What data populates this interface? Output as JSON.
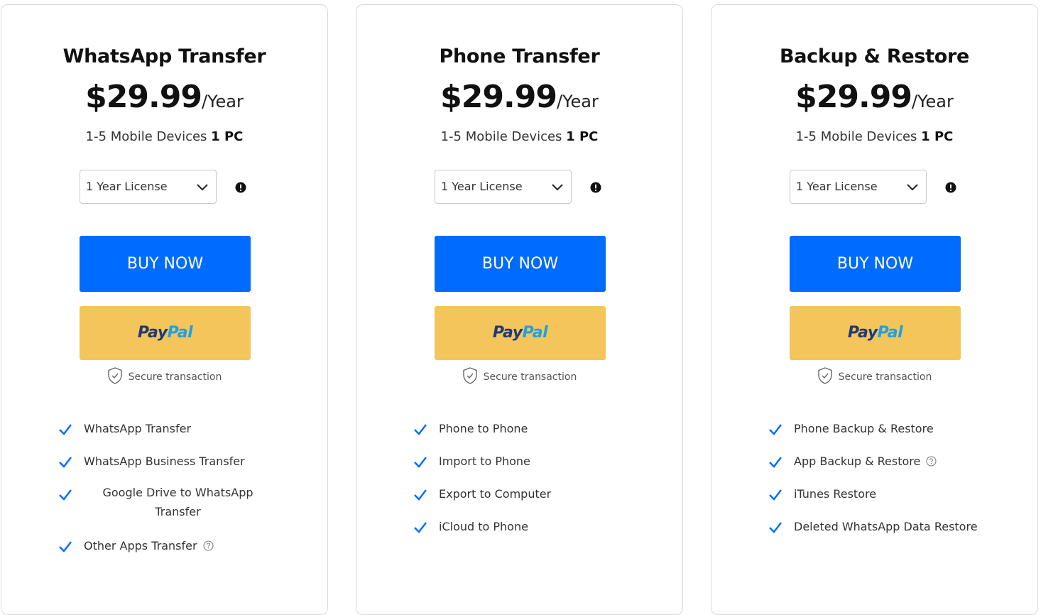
{
  "cards": [
    {
      "title": "WhatsApp Transfer",
      "price": "$29.99",
      "period": "/Year",
      "devices_prefix": "1-5 Mobile Devices",
      "devices_pc": "1 PC",
      "license": "1 Year License",
      "buy_label": "BUY NOW",
      "paypal_pay": "Pay",
      "paypal_pal": "Pal",
      "secure_label": "Secure transaction",
      "features": [
        "WhatsApp Transfer",
        "WhatsApp Business Transfer",
        "Google Drive to WhatsApp Transfer",
        "Other Apps Transfer"
      ]
    },
    {
      "title": "Phone Transfer",
      "price": "$29.99",
      "period": "/Year",
      "devices_prefix": "1-5 Mobile Devices",
      "devices_pc": "1 PC",
      "license": "1 Year License",
      "buy_label": "BUY NOW",
      "paypal_pay": "Pay",
      "paypal_pal": "Pal",
      "secure_label": "Secure transaction",
      "features": [
        "Phone to Phone",
        "Import to Phone",
        "Export to Computer",
        "iCloud to Phone"
      ]
    },
    {
      "title": "Backup & Restore",
      "price": "$29.99",
      "period": "/Year",
      "devices_prefix": "1-5 Mobile Devices",
      "devices_pc": "1 PC",
      "license": "1 Year License",
      "buy_label": "BUY NOW",
      "paypal_pay": "Pay",
      "paypal_pal": "Pal",
      "secure_label": "Secure transaction",
      "features": [
        "Phone Backup & Restore",
        "App Backup & Restore",
        "iTunes Restore",
        "Deleted WhatsApp Data Restore"
      ]
    }
  ],
  "colors": {
    "buy_button": "#006bff",
    "paypal_button": "#f3c55a",
    "check": "#006bff"
  },
  "icons": {
    "select_chevron": "chevron-down-icon",
    "license_info": "exclamation-circle-icon",
    "secure": "shield-check-icon",
    "feature_check": "checkmark-icon",
    "feature_help": "question-circle-icon"
  }
}
